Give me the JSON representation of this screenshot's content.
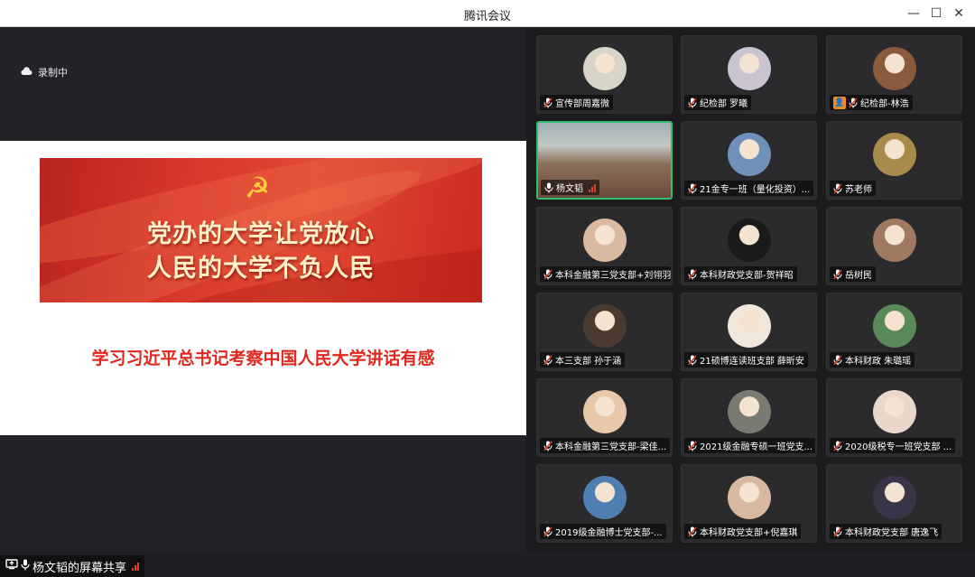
{
  "window": {
    "title": "腾讯会议"
  },
  "recording": {
    "label": "录制中"
  },
  "slide": {
    "banner_line1": "党办的大学让党放心",
    "banner_line2": "人民的大学不负人民",
    "caption": "学习习近平总书记考察中国人民大学讲话有感"
  },
  "share_bar": {
    "label": "杨文韬的屏幕共享"
  },
  "participants": [
    {
      "name": "宣传部周嘉微",
      "muted": true,
      "avatar": "#d8d4c8"
    },
    {
      "name": "纪检部 罗曦",
      "muted": true,
      "avatar": "#c9c4d0"
    },
    {
      "name": "纪检部-林浩",
      "muted": true,
      "avatar": "#8a5a3c",
      "badge": true
    },
    {
      "name": "杨文韬",
      "muted": false,
      "video": true,
      "speaking": true
    },
    {
      "name": "21金专一班（量化投资）...",
      "muted": true,
      "avatar": "#6f90b8"
    },
    {
      "name": "苏老师",
      "muted": true,
      "avatar": "#a88a4a"
    },
    {
      "name": "本科金融第三党支部+刘翎羽",
      "muted": true,
      "avatar": "#d9b9a0"
    },
    {
      "name": "本科财政党支部-贺祥昭",
      "muted": true,
      "avatar": "#1a1a1a"
    },
    {
      "name": "岳树民",
      "muted": true,
      "avatar": "#a07a60"
    },
    {
      "name": "本三支部  孙于涵",
      "muted": true,
      "avatar": "#4a3a30"
    },
    {
      "name": "21硕博连读班支部 薛昕安",
      "muted": true,
      "avatar": "#f0e6da"
    },
    {
      "name": "本科财政 朱璐瑶",
      "muted": true,
      "avatar": "#5a8a5a"
    },
    {
      "name": "本科金融第三党支部-梁佳...",
      "muted": true,
      "avatar": "#e8c8a8"
    },
    {
      "name": "2021级金融专硕一班党支...",
      "muted": true,
      "avatar": "#7a7a72"
    },
    {
      "name": "2020级税专一班党支部 ...",
      "muted": true,
      "avatar": "#e8d8cc"
    },
    {
      "name": "2019级金融博士党支部-...",
      "muted": true,
      "avatar": "#4f7fb0"
    },
    {
      "name": "本科财政党支部+倪嘉琪",
      "muted": true,
      "avatar": "#d8b8a0"
    },
    {
      "name": "本科财政党支部 唐逸飞",
      "muted": true,
      "avatar": "#3a3448"
    }
  ]
}
